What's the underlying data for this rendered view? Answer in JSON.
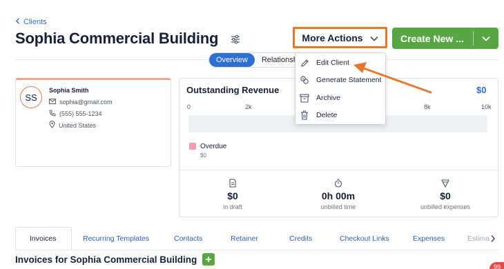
{
  "header": {
    "breadcrumb_label": "Clients",
    "title": "Sophia Commercial Building",
    "more_actions_label": "More Actions",
    "create_new_label": "Create New ..."
  },
  "view_toggle": {
    "active_label": "Overview",
    "other_label": "Relationsh"
  },
  "more_actions_menu": {
    "items": [
      {
        "label": "Edit Client",
        "icon": "pencil-icon"
      },
      {
        "label": "Generate Statement",
        "icon": "statement-icon"
      },
      {
        "label": "Archive",
        "icon": "archive-icon"
      },
      {
        "label": "Delete",
        "icon": "trash-icon"
      }
    ]
  },
  "client_card": {
    "initials": "SS",
    "name": "Sophia Smith",
    "email": "sophia@gmail.com",
    "phone": "(555) 555-1234",
    "location": "United States"
  },
  "revenue": {
    "title": "Outstanding Revenue",
    "total": "$0",
    "ticks": [
      "0",
      "2k",
      "8k",
      "10k"
    ],
    "legend_label": "Overdue",
    "legend_value": "$0",
    "stats": [
      {
        "value": "$0",
        "label": "in draft",
        "icon": "draft-icon"
      },
      {
        "value": "0h 00m",
        "label": "unbilled time",
        "icon": "stopwatch-icon"
      },
      {
        "value": "$0",
        "label": "unbilled expenses",
        "icon": "expense-icon"
      }
    ]
  },
  "tabs": [
    "Invoices",
    "Recurring Templates",
    "Contacts",
    "Retainer",
    "Credits",
    "Checkout Links",
    "Expenses",
    "Estima"
  ],
  "section": {
    "title": "Invoices for Sophia Commercial Building"
  },
  "notification_badge": "99",
  "colors": {
    "accent_blue": "#2f6fd1",
    "primary_green": "#58a543",
    "highlight_orange": "#e8772e",
    "overdue_pink": "#f29bb0"
  }
}
